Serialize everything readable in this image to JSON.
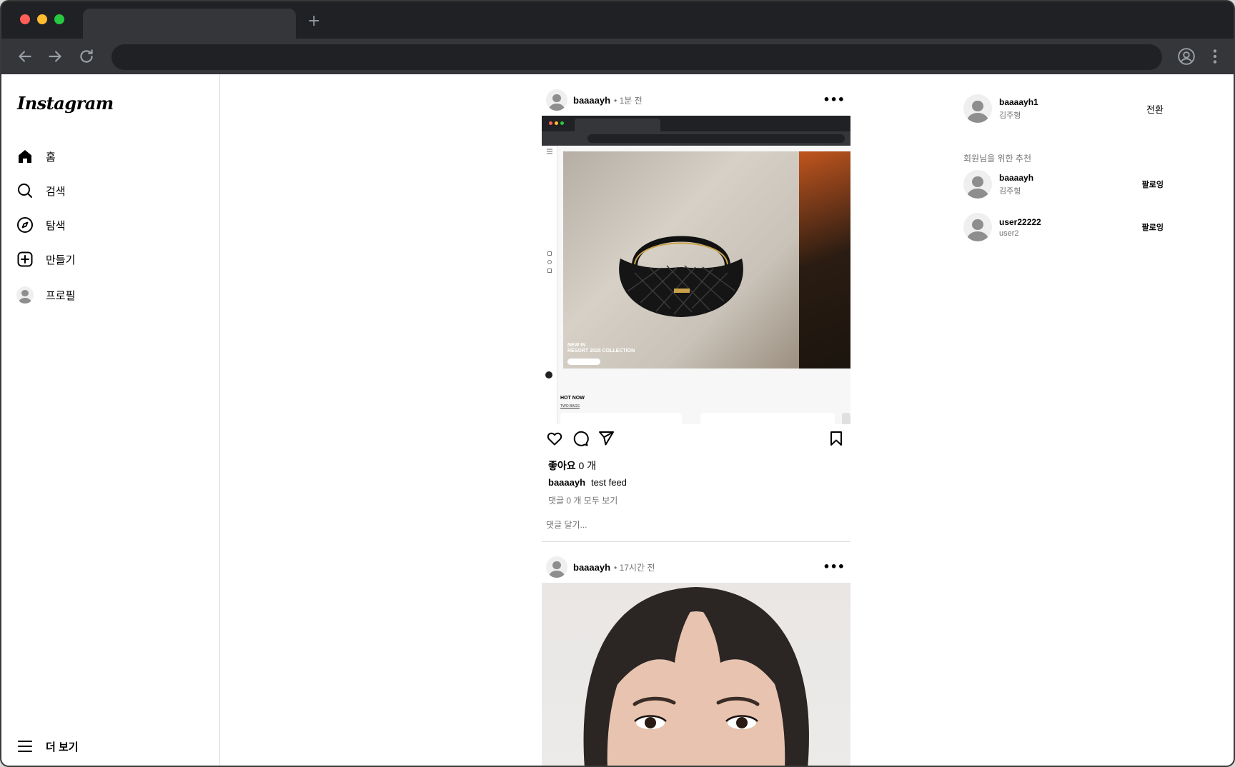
{
  "browser": {
    "new_tab": "+"
  },
  "sidebar": {
    "logo": "Instagram",
    "items": [
      {
        "label": "홈",
        "icon": "home-icon"
      },
      {
        "label": "검색",
        "icon": "search-icon"
      },
      {
        "label": "탐색",
        "icon": "compass-icon"
      },
      {
        "label": "만들기",
        "icon": "plus-square-icon"
      },
      {
        "label": "프로필",
        "icon": "profile-avatar-icon"
      }
    ],
    "more": {
      "label": "더 보기",
      "icon": "hamburger-menu-icon"
    }
  },
  "feed": {
    "posts": [
      {
        "username": "baaaayh",
        "time": "• 1분 전",
        "embedded": {
          "hero_line1": "NEW IN",
          "hero_line2": "RESORT 2025 COLLECTION",
          "hot_now": "HOT NOW",
          "hot_sub": "TWO BAGS"
        },
        "likes_label": "좋아요",
        "likes_count": "0 개",
        "caption_user": "baaaayh",
        "caption_text": "test feed",
        "view_comments": "댓글 0 개 모두 보기",
        "comment_placeholder": "댓글 달기..."
      },
      {
        "username": "baaaayh",
        "time": "• 17시간 전"
      }
    ]
  },
  "right_panel": {
    "current_user": {
      "username": "baaaayh1",
      "name": "김주형",
      "action": "전환"
    },
    "suggestions_title": "회원님을 위한 추천",
    "suggestions": [
      {
        "username": "baaaayh",
        "name": "김주형",
        "action": "팔로잉"
      },
      {
        "username": "user22222",
        "name": "user2",
        "action": "팔로잉"
      }
    ]
  },
  "colors": {
    "accent": "#000000",
    "secondary_text": "#737373",
    "border": "#dbdbdb"
  }
}
